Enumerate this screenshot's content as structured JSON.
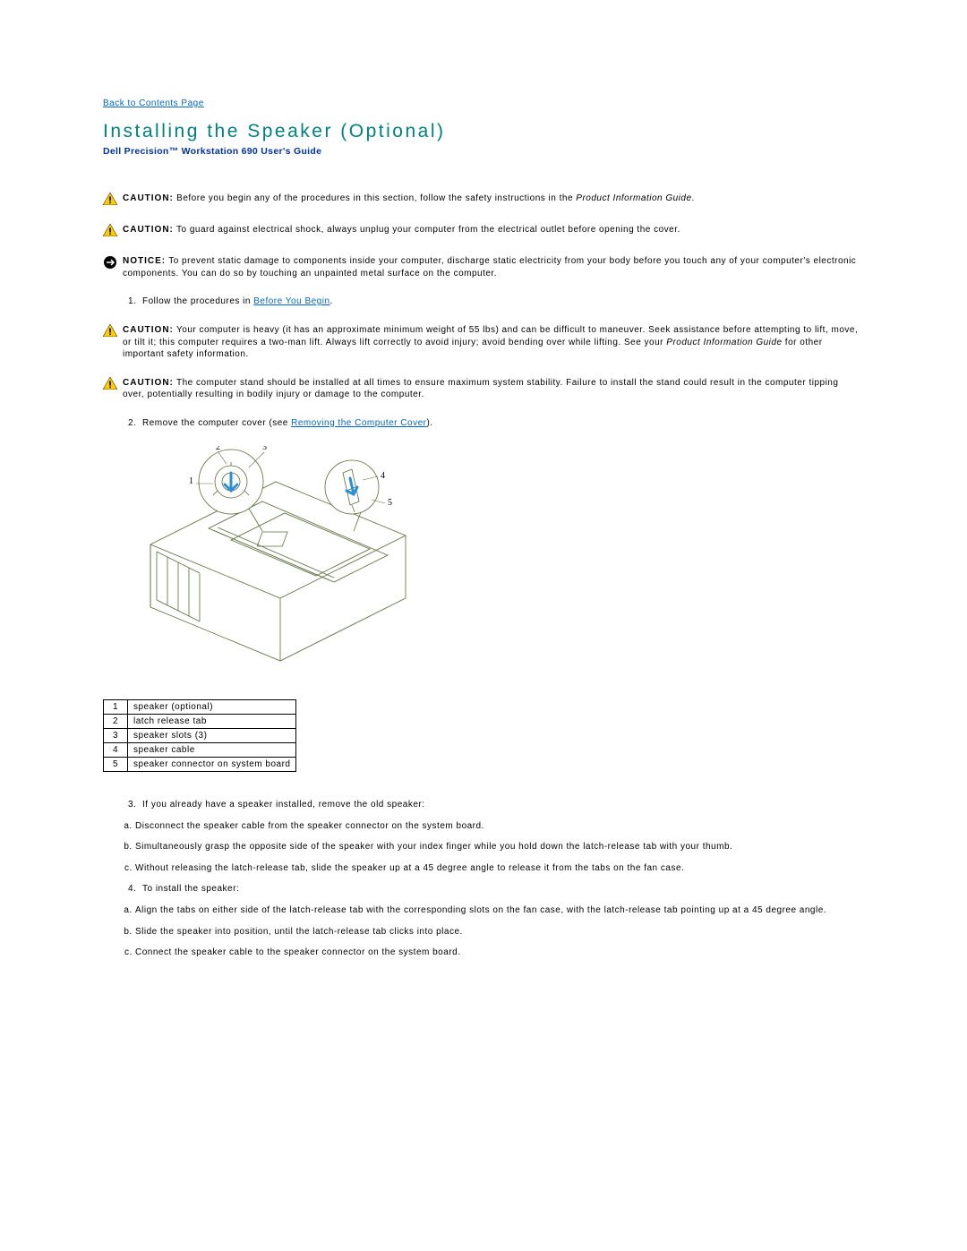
{
  "backLink": "Back to Contents Page",
  "title": "Installing the Speaker (Optional)",
  "subtitle": "Dell Precision™ Workstation 690 User's Guide",
  "caution1": "Before you begin any of the procedures in this section, follow the safety instructions in the ",
  "caution1_em": "Product Information Guide",
  "caution1_end": ".",
  "caution2": "To guard against electrical shock, always unplug your computer from the electrical outlet before opening the cover.",
  "notice1": "To prevent static damage to components inside your computer, discharge static electricity from your body before you touch any of your computer's electronic components. You can do so by touching an unpainted metal surface on the computer.",
  "step1_a": "Follow the procedures in ",
  "step1_link": "Before You Begin",
  "step1_b": ".",
  "caution3": "Your computer is heavy (it has an approximate minimum weight of 55 lbs) and can be difficult to maneuver. Seek assistance before attempting to lift, move, or tilt it; this computer requires a two-man lift. Always lift correctly to avoid injury; avoid bending over while lifting. See your ",
  "caution3_em": "Product Information Guide",
  "caution3_end": " for other important safety information.",
  "caution4": "The computer stand should be installed at all times to ensure maximum system stability. Failure to install the stand could result in the computer tipping over, potentially resulting in bodily injury or damage to the computer.",
  "step2_a": "Remove the computer cover (see ",
  "step2_link": "Removing the Computer Cover",
  "step2_b": ").",
  "parts": [
    {
      "n": "1",
      "label": "speaker (optional)"
    },
    {
      "n": "2",
      "label": "latch release tab"
    },
    {
      "n": "3",
      "label": "speaker slots (3)"
    },
    {
      "n": "4",
      "label": "speaker cable"
    },
    {
      "n": "5",
      "label": "speaker connector on system board"
    }
  ],
  "step3": "If you already have a speaker installed, remove the old speaker:",
  "step3a": "Disconnect the speaker cable from the speaker connector on the system board.",
  "step3b": "Simultaneously grasp the opposite side of the speaker with your index finger while you hold down the latch-release tab with your thumb.",
  "step3c": "Without releasing the latch-release tab, slide the speaker up at a 45 degree angle to release it from the tabs on the fan case.",
  "step4": "To install the speaker:",
  "step4a": "Align the tabs on either side of the latch-release tab with the corresponding slots on the fan case, with the latch-release tab pointing up at a 45 degree angle.",
  "step4b": "Slide the speaker into position, until the latch-release tab clicks into place.",
  "step4c": "Connect the speaker cable to the speaker connector on the system board.",
  "labels": {
    "caution": "CAUTION:",
    "notice": "NOTICE:"
  }
}
